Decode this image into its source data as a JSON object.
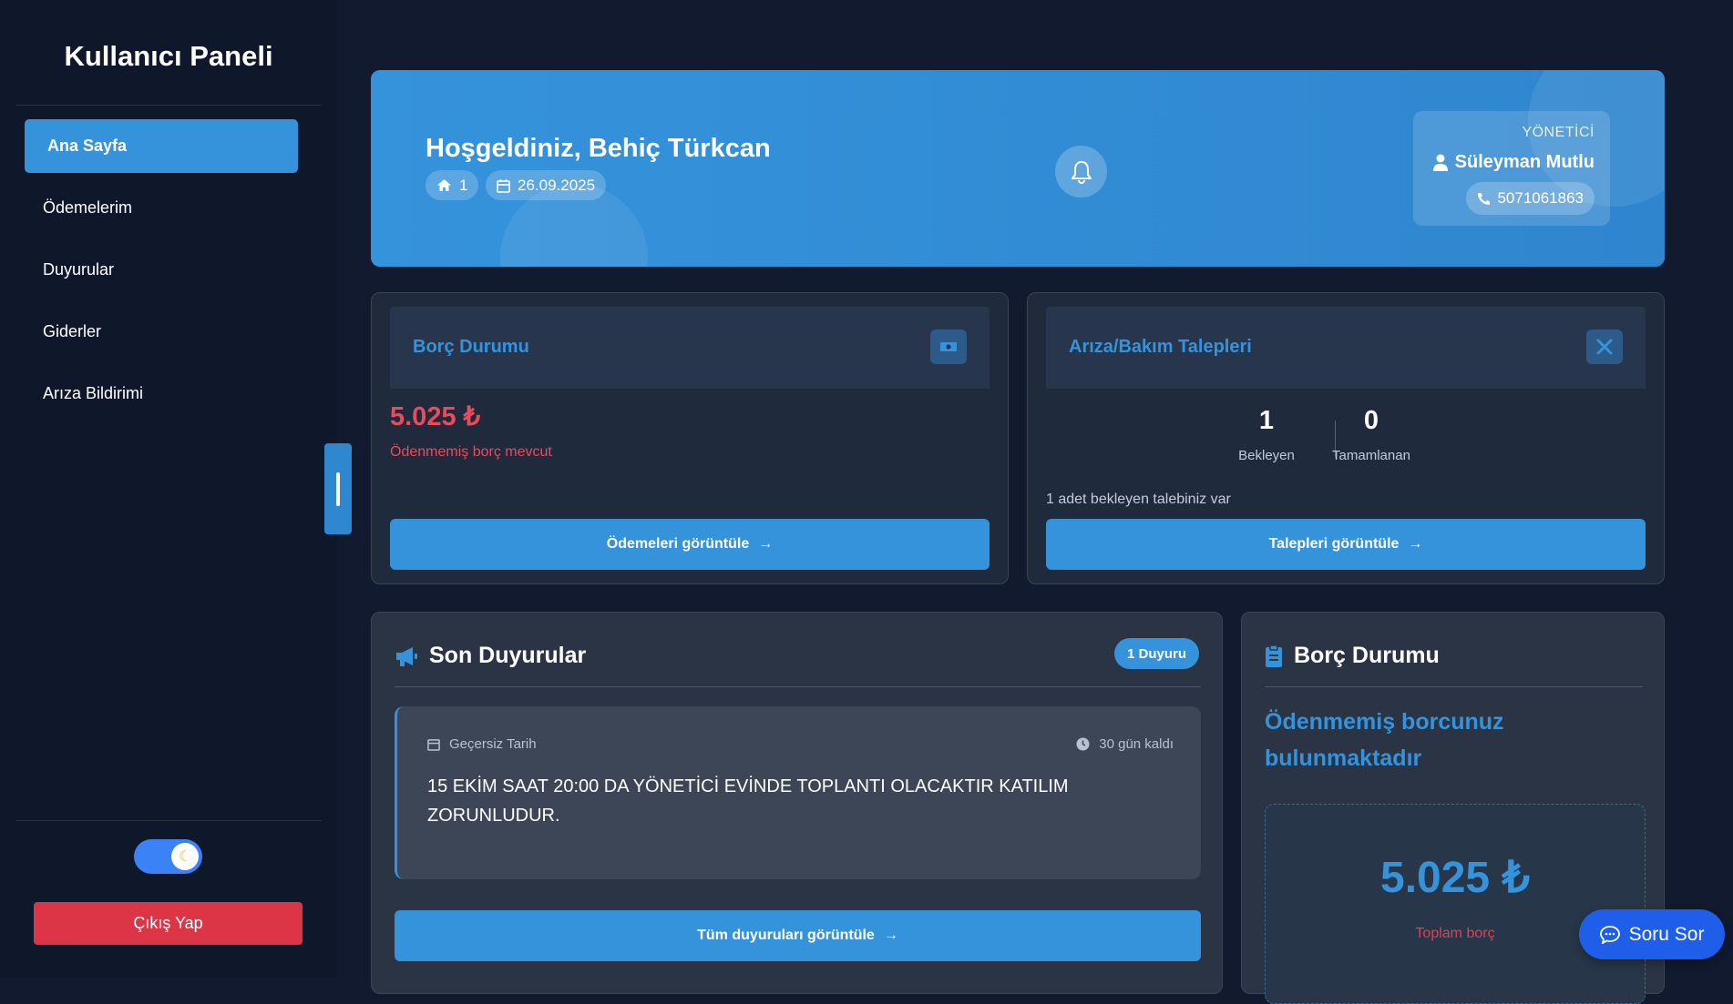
{
  "sidebar": {
    "title": "Kullanıcı Paneli",
    "items": [
      {
        "label": "Ana Sayfa"
      },
      {
        "label": "Ödemelerim"
      },
      {
        "label": "Duyurular"
      },
      {
        "label": "Giderler"
      },
      {
        "label": "Arıza Bildirimi"
      }
    ],
    "logout_label": "Çıkış Yap"
  },
  "hero": {
    "greeting": "Hoşgeldiniz, Behiç Türkcan",
    "flat_no": "1",
    "date": "26.09.2025",
    "manager_role": "YÖNETİCİ",
    "manager_name": "Süleyman Mutlu",
    "manager_phone": "5071061863"
  },
  "debt_card": {
    "title": "Borç Durumu",
    "amount": "5.025 ₺",
    "status": "Ödenmemiş borç mevcut",
    "button": "Ödemeleri görüntüle"
  },
  "maintenance_card": {
    "title": "Arıza/Bakım Talepleri",
    "pending_count": "1",
    "pending_label": "Bekleyen",
    "completed_count": "0",
    "completed_label": "Tamamlanan",
    "info": "1 adet bekleyen talebiniz var",
    "button": "Talepleri görüntüle"
  },
  "announcements": {
    "title": "Son Duyurular",
    "badge": "1 Duyuru",
    "items": [
      {
        "date": "Geçersiz Tarih",
        "remaining": "30 gün kaldı",
        "text": "15 EKİM SAAT 20:00 DA YÖNETİCİ EVİNDE TOPLANTI OLACAKTIR KATILIM ZORUNLUDUR."
      }
    ],
    "button": "Tüm duyuruları görüntüle"
  },
  "debt_summary": {
    "title": "Borç Durumu",
    "message": "Ödenmemiş borcunuz bulunmaktadır",
    "amount": "5.025 ₺",
    "label": "Toplam borç"
  },
  "fab": {
    "label": "Soru Sor"
  },
  "colors": {
    "accent": "#3593db",
    "danger": "#dc3545",
    "background": "#111a2e"
  }
}
